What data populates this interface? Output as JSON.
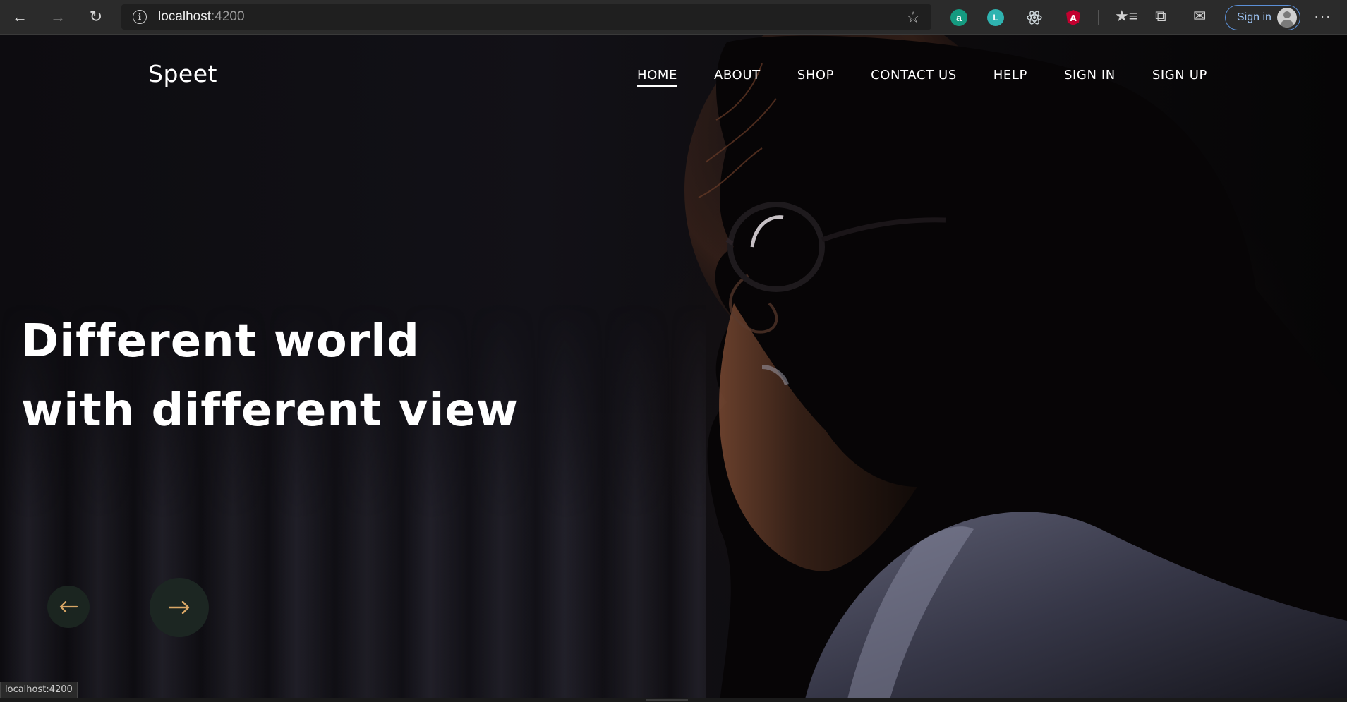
{
  "browser": {
    "url_host": "localhost",
    "url_port": ":4200",
    "signin_label": "Sign in",
    "extensions": [
      {
        "name": "a",
        "color": "#1aa58a"
      },
      {
        "name": "grammarly-like",
        "color": "#2ec4b6"
      },
      {
        "name": "react",
        "color": "#61dafb"
      },
      {
        "name": "angular",
        "color": "#dd0031"
      }
    ]
  },
  "site": {
    "logo": "Speet",
    "nav": [
      "HOME",
      "ABOUT",
      "SHOP",
      "CONTACT US",
      "HELP",
      "SIGN IN",
      "SIGN UP"
    ],
    "active_nav": "HOME"
  },
  "hero": {
    "headline_line1": "Different world",
    "headline_line2": "with different view"
  },
  "slider": {
    "arrow_color": "#d9a766"
  },
  "status_bar": {
    "text": "localhost:4200"
  }
}
